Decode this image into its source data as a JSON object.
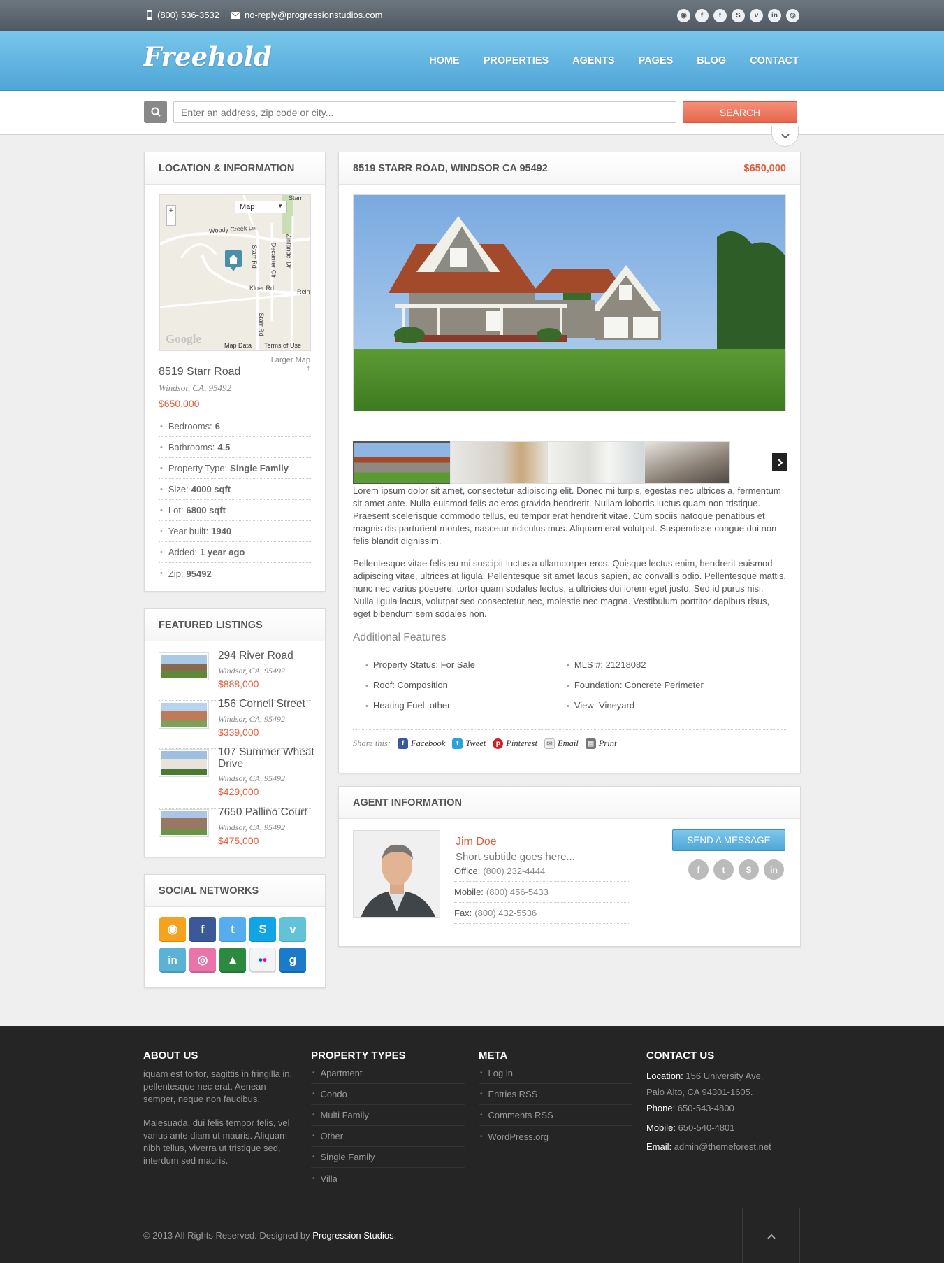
{
  "topbar": {
    "phone": "(800) 536-3532",
    "email": "no-reply@progressionstudios.com",
    "social_icons": [
      "rss-icon",
      "facebook-icon",
      "twitter-icon",
      "skype-icon",
      "vimeo-icon",
      "linkedin-icon",
      "dribbble-icon"
    ]
  },
  "header": {
    "logo": "Freehold",
    "nav": [
      "HOME",
      "PROPERTIES",
      "AGENTS",
      "PAGES",
      "BLOG",
      "CONTACT"
    ]
  },
  "search": {
    "placeholder": "Enter an address, zip code or city...",
    "button": "SEARCH"
  },
  "location": {
    "title": "LOCATION & INFORMATION",
    "map": {
      "type_label": "Map",
      "zoom_in": "+",
      "zoom_out": "−",
      "streets": [
        "Woody Creek Ln",
        "Starr Rd",
        "Decanter Cir",
        "Zinfandel Dr",
        "Kloer Rd",
        "Starr Rd",
        "Reiner",
        "Starr"
      ],
      "google": "Google",
      "map_data": "Map Data",
      "terms": "Terms of Use",
      "larger": "Larger Map ↑"
    },
    "address": "8519 Starr Road",
    "city": "Windsor, CA, 95492",
    "price": "$650,000",
    "details": [
      {
        "k": "Bedrooms:",
        "v": "6"
      },
      {
        "k": "Bathrooms:",
        "v": "4.5"
      },
      {
        "k": "Property Type:",
        "v": "Single Family"
      },
      {
        "k": "Size:",
        "v": "4000 sqft"
      },
      {
        "k": "Lot:",
        "v": "6800 sqft"
      },
      {
        "k": "Year built:",
        "v": "1940"
      },
      {
        "k": "Added:",
        "v": "1 year ago"
      },
      {
        "k": "Zip:",
        "v": "95492"
      }
    ]
  },
  "featured": {
    "title": "FEATURED LISTINGS",
    "items": [
      {
        "name": "294 River Road",
        "addr": "Windsor, CA, 95492",
        "price": "$888,000"
      },
      {
        "name": "156 Cornell Street",
        "addr": "Windsor, CA, 95492",
        "price": "$339,000"
      },
      {
        "name": "107 Summer Wheat Drive",
        "addr": "Windsor, CA, 95492",
        "price": "$429,000"
      },
      {
        "name": "7650 Pallino Court",
        "addr": "Windsor, CA, 95492",
        "price": "$475,000"
      }
    ]
  },
  "social": {
    "title": "SOCIAL NETWORKS",
    "icons": [
      {
        "name": "rss-icon",
        "glyph": "◉",
        "color": "#f6a21e"
      },
      {
        "name": "facebook-icon",
        "glyph": "f",
        "color": "#3b5998"
      },
      {
        "name": "twitter-icon",
        "glyph": "t",
        "color": "#55acee"
      },
      {
        "name": "skype-icon",
        "glyph": "S",
        "color": "#12a5e6"
      },
      {
        "name": "vimeo-icon",
        "glyph": "v",
        "color": "#62c3d8"
      },
      {
        "name": "linkedin-icon",
        "glyph": "in",
        "color": "#5ab3d6"
      },
      {
        "name": "dribbble-icon",
        "glyph": "◎",
        "color": "#ea73a7"
      },
      {
        "name": "forrst-icon",
        "glyph": "▲",
        "color": "#2c8a3f"
      },
      {
        "name": "flickr-icon",
        "glyph": "••",
        "color": "#f4f4f4"
      },
      {
        "name": "google-icon",
        "glyph": "g",
        "color": "#1b7ac9"
      }
    ]
  },
  "property": {
    "title": "8519 STARR ROAD, WINDSOR CA 95492",
    "price": "$650,000",
    "desc1": "Lorem ipsum dolor sit amet, consectetur adipiscing elit. Donec mi turpis, egestas nec ultrices a, fermentum sit amet ante. Nulla euismod felis ac eros gravida hendrerit. Nullam lobortis luctus quam non tristique. Praesent scelerisque commodo tellus, eu tempor erat hendrerit vitae. Cum sociis natoque penatibus et magnis dis parturient montes, nascetur ridiculus mus. Aliquam erat volutpat. Suspendisse congue dui non felis blandit dignissim.",
    "desc2": "Pellentesque vitae felis eu mi suscipit luctus a ullamcorper eros. Quisque lectus enim, hendrerit euismod adipiscing vitae, ultrices at ligula. Pellentesque sit amet lacus sapien, ac convallis odio. Pellentesque mattis, nunc nec varius posuere, tortor quam sodales lectus, a ultricies dui lorem eget justo. Sed id purus nisi. Nulla ligula lacus, volutpat sed consectetur nec, molestie nec magna. Vestibulum porttitor dapibus risus, eget bibendum sem sodales non.",
    "features_title": "Additional Features",
    "features_left": [
      "Property Status: For Sale",
      "Roof: Composition",
      "Heating Fuel: other"
    ],
    "features_right": [
      "MLS #: 21218082",
      "Foundation: Concrete Perimeter",
      "View: Vineyard"
    ],
    "share_label": "Share this:",
    "share": [
      "Facebook",
      "Tweet",
      "Pinterest",
      "Email",
      "Print"
    ]
  },
  "agent": {
    "title": "AGENT INFORMATION",
    "name": "Jim Doe",
    "subtitle": "Short subtitle goes here...",
    "office_k": "Office:",
    "office": "(800) 232-4444",
    "mobile_k": "Mobile:",
    "mobile": "(800) 456-5433",
    "fax_k": "Fax:",
    "fax": "(800) 432-5536",
    "button": "SEND A MESSAGE"
  },
  "footer": {
    "about_title": "ABOUT US",
    "about1": "iquam est tortor, sagittis in fringilla in, pellentesque nec erat. Aenean semper, neque non faucibus.",
    "about2": "Malesuada, dui felis tempor felis, vel varius ante diam ut mauris. Aliquam nibh tellus, viverra ut tristique sed, interdum sed mauris.",
    "types_title": "PROPERTY TYPES",
    "types": [
      "Apartment",
      "Condo",
      "Multi Family",
      "Other",
      "Single Family",
      "Villa"
    ],
    "meta_title": "META",
    "meta": [
      "Log in",
      "Entries RSS",
      "Comments RSS",
      "WordPress.org"
    ],
    "contact_title": "CONTACT US",
    "loc_k": "Location:",
    "loc": "156 University Ave.",
    "loc2": "Palo Alto, CA 94301-1605.",
    "phone_k": "Phone:",
    "phone": "650-543-4800",
    "mobile_k": "Mobile:",
    "mobile": "650-540-4801",
    "email_k": "Email:",
    "email": "admin@themeforest.net",
    "copyright": "© 2013 All Rights Reserved. Designed by",
    "designer": "Progression Studios",
    "period": "."
  }
}
